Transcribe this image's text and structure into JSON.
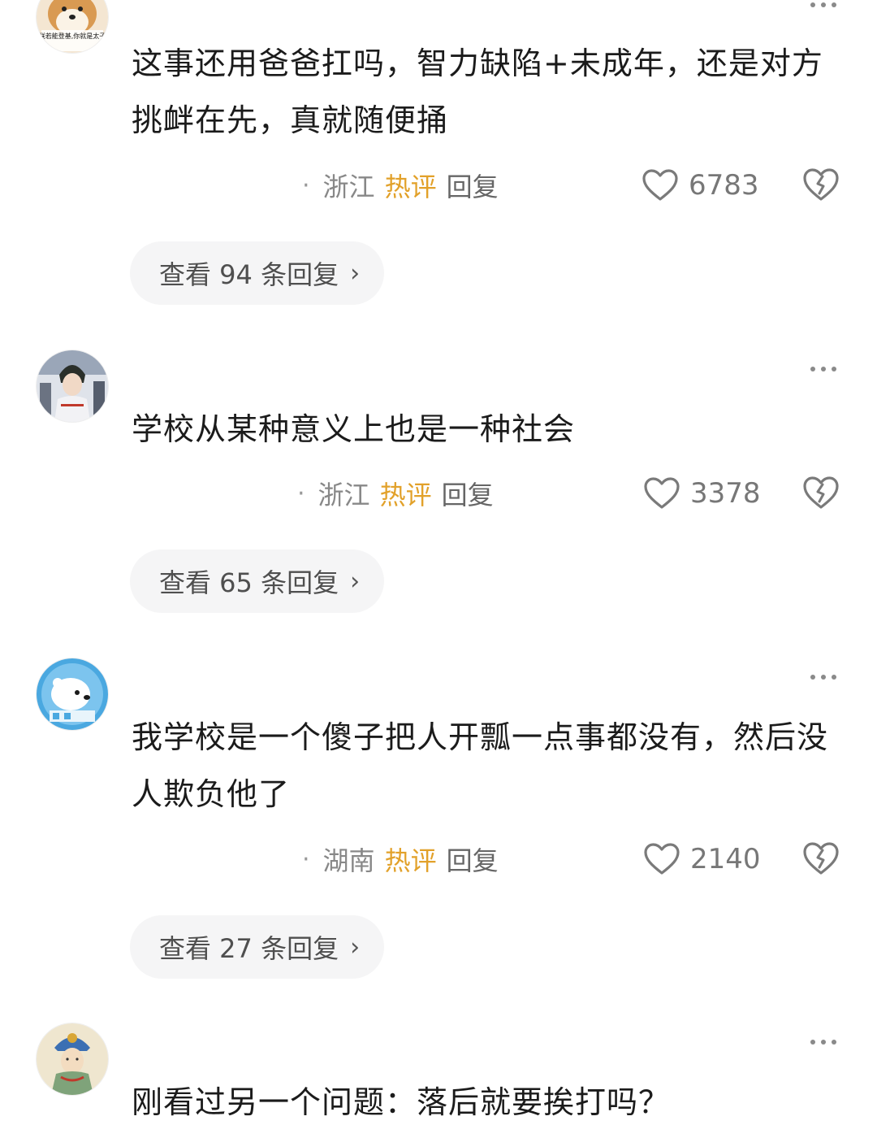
{
  "comments": [
    {
      "text": "这事还用爸爸扛吗，智力缺陷+未成年，还是对方挑衅在先，真就随便捅",
      "location": "浙江",
      "hot_label": "热评",
      "reply_label": "回复",
      "likes": "6783",
      "replies_label": "查看 94 条回复",
      "avatar_icon": "shiba-dog-avatar",
      "avatar_text": "朕若能登基,你就是太子"
    },
    {
      "text": "学校从某种意义上也是一种社会",
      "location": "浙江",
      "hot_label": "热评",
      "reply_label": "回复",
      "likes": "3378",
      "replies_label": "查看 65 条回复",
      "avatar_icon": "anime-boy-avatar"
    },
    {
      "text": "我学校是一个傻子把人开瓢一点事都没有，然后没人欺负他了",
      "location": "湖南",
      "hot_label": "热评",
      "reply_label": "回复",
      "likes": "2140",
      "replies_label": "查看 27 条回复",
      "avatar_icon": "white-bear-avatar"
    },
    {
      "text": "刚看过另一个问题：落后就要挨打吗？",
      "avatar_icon": "bodhisattva-painting-avatar"
    }
  ],
  "icons": {
    "more": "more-dots-icon",
    "like": "heart-icon",
    "dislike": "broken-heart-icon",
    "chevron": "chevron-right-icon"
  },
  "colors": {
    "hot": "#e2a12a",
    "meta": "#888888",
    "pill_bg": "#f5f5f6"
  }
}
